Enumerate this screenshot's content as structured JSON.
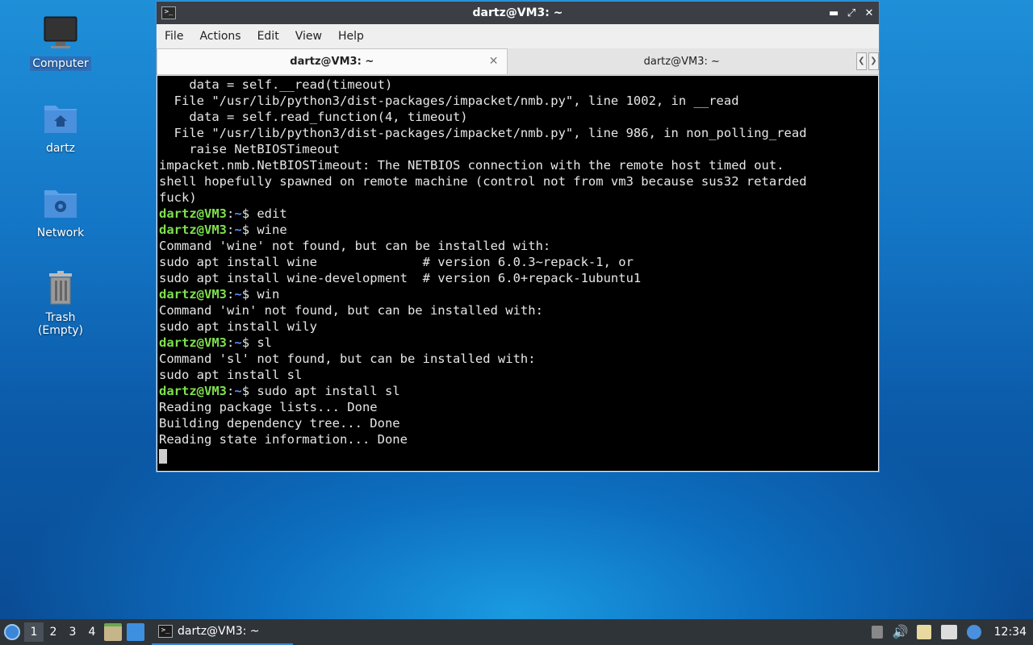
{
  "desktop": {
    "icons": [
      {
        "label": "Computer"
      },
      {
        "label": "dartz"
      },
      {
        "label": "Network"
      },
      {
        "label": "Trash (Empty)"
      }
    ]
  },
  "window": {
    "title": "dartz@VM3: ~",
    "menu": [
      "File",
      "Actions",
      "Edit",
      "View",
      "Help"
    ],
    "tabs": [
      {
        "label": "dartz@VM3: ~"
      },
      {
        "label": "dartz@VM3: ~"
      }
    ]
  },
  "terminal": {
    "prompt_user": "dartz@VM3",
    "prompt_path": "~",
    "lines": [
      {
        "text": "    data = self.__read(timeout)"
      },
      {
        "text": "  File \"/usr/lib/python3/dist-packages/impacket/nmb.py\", line 1002, in __read"
      },
      {
        "text": "    data = self.read_function(4, timeout)"
      },
      {
        "text": "  File \"/usr/lib/python3/dist-packages/impacket/nmb.py\", line 986, in non_polling_read"
      },
      {
        "text": "    raise NetBIOSTimeout"
      },
      {
        "text": "impacket.nmb.NetBIOSTimeout: The NETBIOS connection with the remote host timed out."
      },
      {
        "text": "shell hopefully spawned on remote machine (control not from vm3 because sus32 retarded"
      },
      {
        "text": "fuck)"
      },
      {
        "prompt": true,
        "cmd": "edit"
      },
      {
        "prompt": true,
        "cmd": "wine"
      },
      {
        "text": "Command 'wine' not found, but can be installed with:"
      },
      {
        "text": "sudo apt install wine              # version 6.0.3~repack-1, or"
      },
      {
        "text": "sudo apt install wine-development  # version 6.0+repack-1ubuntu1"
      },
      {
        "prompt": true,
        "cmd": "win"
      },
      {
        "text": "Command 'win' not found, but can be installed with:"
      },
      {
        "text": "sudo apt install wily"
      },
      {
        "prompt": true,
        "cmd": "sl"
      },
      {
        "text": "Command 'sl' not found, but can be installed with:"
      },
      {
        "text": "sudo apt install sl"
      },
      {
        "prompt": true,
        "cmd": "sudo apt install sl"
      },
      {
        "text": "Reading package lists... Done"
      },
      {
        "text": "Building dependency tree... Done"
      },
      {
        "text": "Reading state information... Done"
      }
    ]
  },
  "taskbar": {
    "workspaces": [
      "1",
      "2",
      "3",
      "4"
    ],
    "task_label": "dartz@VM3: ~",
    "clock": "12:34"
  }
}
